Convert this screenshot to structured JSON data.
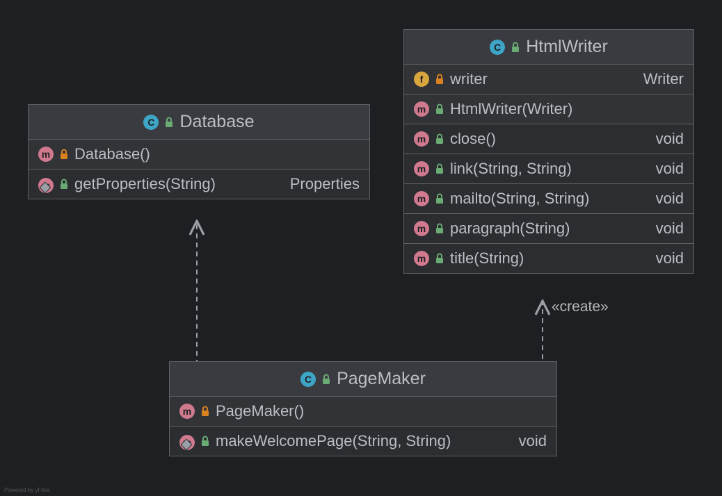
{
  "powered": "Powered by yFiles",
  "labels": {
    "create": "«create»"
  },
  "classes": {
    "database": {
      "name": "Database",
      "rows": [
        {
          "kind": "m",
          "vis": "private",
          "override": false,
          "sig": "Database()",
          "ret": ""
        },
        {
          "kind": "m",
          "vis": "public",
          "override": true,
          "sig": "getProperties(String)",
          "ret": "Properties"
        }
      ]
    },
    "htmlwriter": {
      "name": "HtmlWriter",
      "rows": [
        {
          "kind": "f",
          "vis": "private",
          "override": false,
          "sig": "writer",
          "ret": "Writer"
        },
        {
          "kind": "m",
          "vis": "public",
          "override": false,
          "sig": "HtmlWriter(Writer)",
          "ret": ""
        },
        {
          "kind": "m",
          "vis": "public",
          "override": false,
          "sig": "close()",
          "ret": "void"
        },
        {
          "kind": "m",
          "vis": "public",
          "override": false,
          "sig": "link(String, String)",
          "ret": "void"
        },
        {
          "kind": "m",
          "vis": "public",
          "override": false,
          "sig": "mailto(String, String)",
          "ret": "void"
        },
        {
          "kind": "m",
          "vis": "public",
          "override": false,
          "sig": "paragraph(String)",
          "ret": "void"
        },
        {
          "kind": "m",
          "vis": "public",
          "override": false,
          "sig": "title(String)",
          "ret": "void"
        }
      ]
    },
    "pagemaker": {
      "name": "PageMaker",
      "rows": [
        {
          "kind": "m",
          "vis": "private",
          "override": false,
          "sig": "PageMaker()",
          "ret": ""
        },
        {
          "kind": "m",
          "vis": "public",
          "override": true,
          "sig": "makeWelcomePage(String, String)",
          "ret": "void"
        }
      ]
    }
  }
}
